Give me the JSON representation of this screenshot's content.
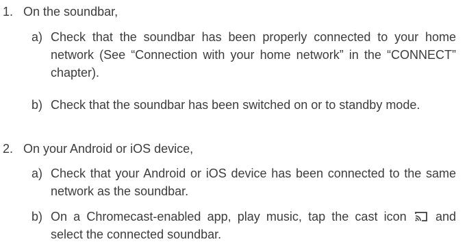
{
  "steps": [
    {
      "number": "1.",
      "heading": "On the soundbar,",
      "items": [
        {
          "letter": "a)",
          "text": "Check that the soundbar has been properly connected to your home network (See “Connection with your home network” in the “CONNECT” chapter)."
        },
        {
          "letter": "b)",
          "text": "Check that the soundbar has been switched on or to standby mode."
        }
      ]
    },
    {
      "number": "2.",
      "heading": "On your Android or iOS device,",
      "items": [
        {
          "letter": "a)",
          "text": "Check that your Android or iOS device has been connected to the same network as the soundbar."
        },
        {
          "letter": "b)",
          "text_before_icon": "On a Chromecast-enabled app, play music, tap the cast icon",
          "icon": "cast-icon",
          "text_after_icon": "and select the connected soundbar."
        }
      ]
    }
  ],
  "colors": {
    "text": "#3c3c3c"
  }
}
